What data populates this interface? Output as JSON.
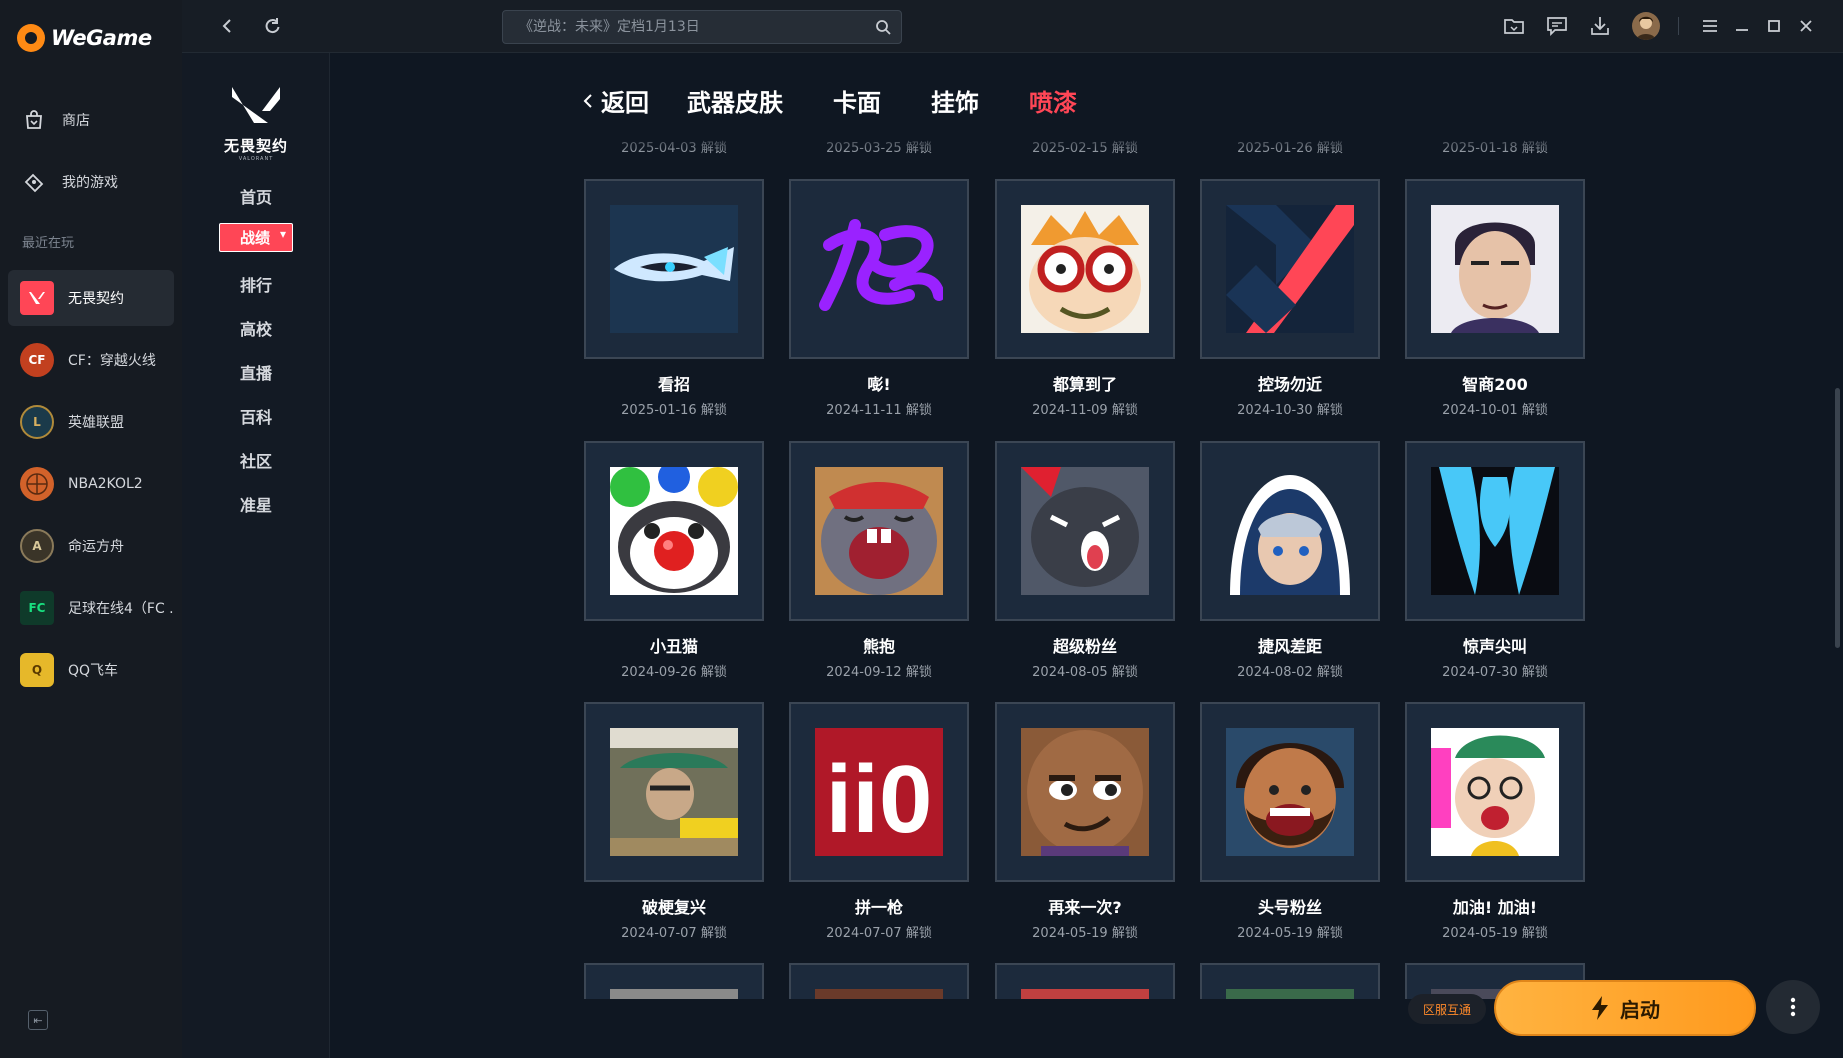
{
  "app": {
    "logo_text": "WeGame"
  },
  "sidebar": {
    "store_label": "商店",
    "mygames_label": "我的游戏",
    "recent_label": "最近在玩",
    "games": [
      {
        "name": "无畏契约",
        "color": "#ff4656"
      },
      {
        "name": "CF：穿越火线",
        "color": "#c2401f"
      },
      {
        "name": "英雄联盟",
        "color": "#b08a3a"
      },
      {
        "name": "NBA2KOL2",
        "color": "#d2622a"
      },
      {
        "name": "命运方舟",
        "color": "#8a7a5a"
      },
      {
        "name": "足球在线4（FC ...",
        "color": "#18b86a"
      },
      {
        "name": "QQ飞车",
        "color": "#e6b82a"
      }
    ]
  },
  "topbar": {
    "search_placeholder": "《逆战：未来》定档1月13日"
  },
  "game_nav": {
    "logo_title": "无畏契约",
    "logo_sub": "VALORANT",
    "items": [
      "首页",
      "战绩",
      "排行",
      "高校",
      "直播",
      "百科",
      "社区",
      "准星"
    ],
    "active_index": 1
  },
  "tabs": {
    "back_label": "返回",
    "items": [
      "武器皮肤",
      "卡面",
      "挂饰",
      "喷漆"
    ],
    "active": "喷漆"
  },
  "cut_dates": [
    "2025-04-03 解锁",
    "2025-03-25 解锁",
    "2025-02-15 解锁",
    "2025-01-26 解锁",
    "2025-01-18 解锁"
  ],
  "sprays": [
    {
      "name": "看招",
      "date": "2025-01-16 解锁",
      "art": "knife"
    },
    {
      "name": "嘭!",
      "date": "2024-11-11 解锁",
      "art": "purple-scribble"
    },
    {
      "name": "都算到了",
      "date": "2024-11-09 解锁",
      "art": "goggles"
    },
    {
      "name": "控场勿近",
      "date": "2024-10-30 解锁",
      "art": "red-slash"
    },
    {
      "name": "智商200",
      "date": "2024-10-01 解锁",
      "art": "portrait"
    },
    {
      "name": "小丑猫",
      "date": "2024-09-26 解锁",
      "art": "clown"
    },
    {
      "name": "熊抱",
      "date": "2024-09-12 解锁",
      "art": "crying"
    },
    {
      "name": "超级粉丝",
      "date": "2024-08-05 解锁",
      "art": "cat"
    },
    {
      "name": "捷风差距",
      "date": "2024-08-02 解锁",
      "art": "hood"
    },
    {
      "name": "惊声尖叫",
      "date": "2024-07-30 解锁",
      "art": "blue-claws"
    },
    {
      "name": "破梗复兴",
      "date": "2024-07-07 解锁",
      "art": "window"
    },
    {
      "name": "拼一枪",
      "date": "2024-07-07 解锁",
      "art": "ii0"
    },
    {
      "name": "再来一次?",
      "date": "2024-05-19 解锁",
      "art": "smirk"
    },
    {
      "name": "头号粉丝",
      "date": "2024-05-19 解锁",
      "art": "laugh"
    },
    {
      "name": "加油! 加油!",
      "date": "2024-05-19 解锁",
      "art": "cheer"
    }
  ],
  "ii0_text": "ii0",
  "region_badge": "区服互通",
  "launch_label": "启动",
  "colors": {
    "accent": "#ff4656",
    "launch": "#ffa42a"
  }
}
